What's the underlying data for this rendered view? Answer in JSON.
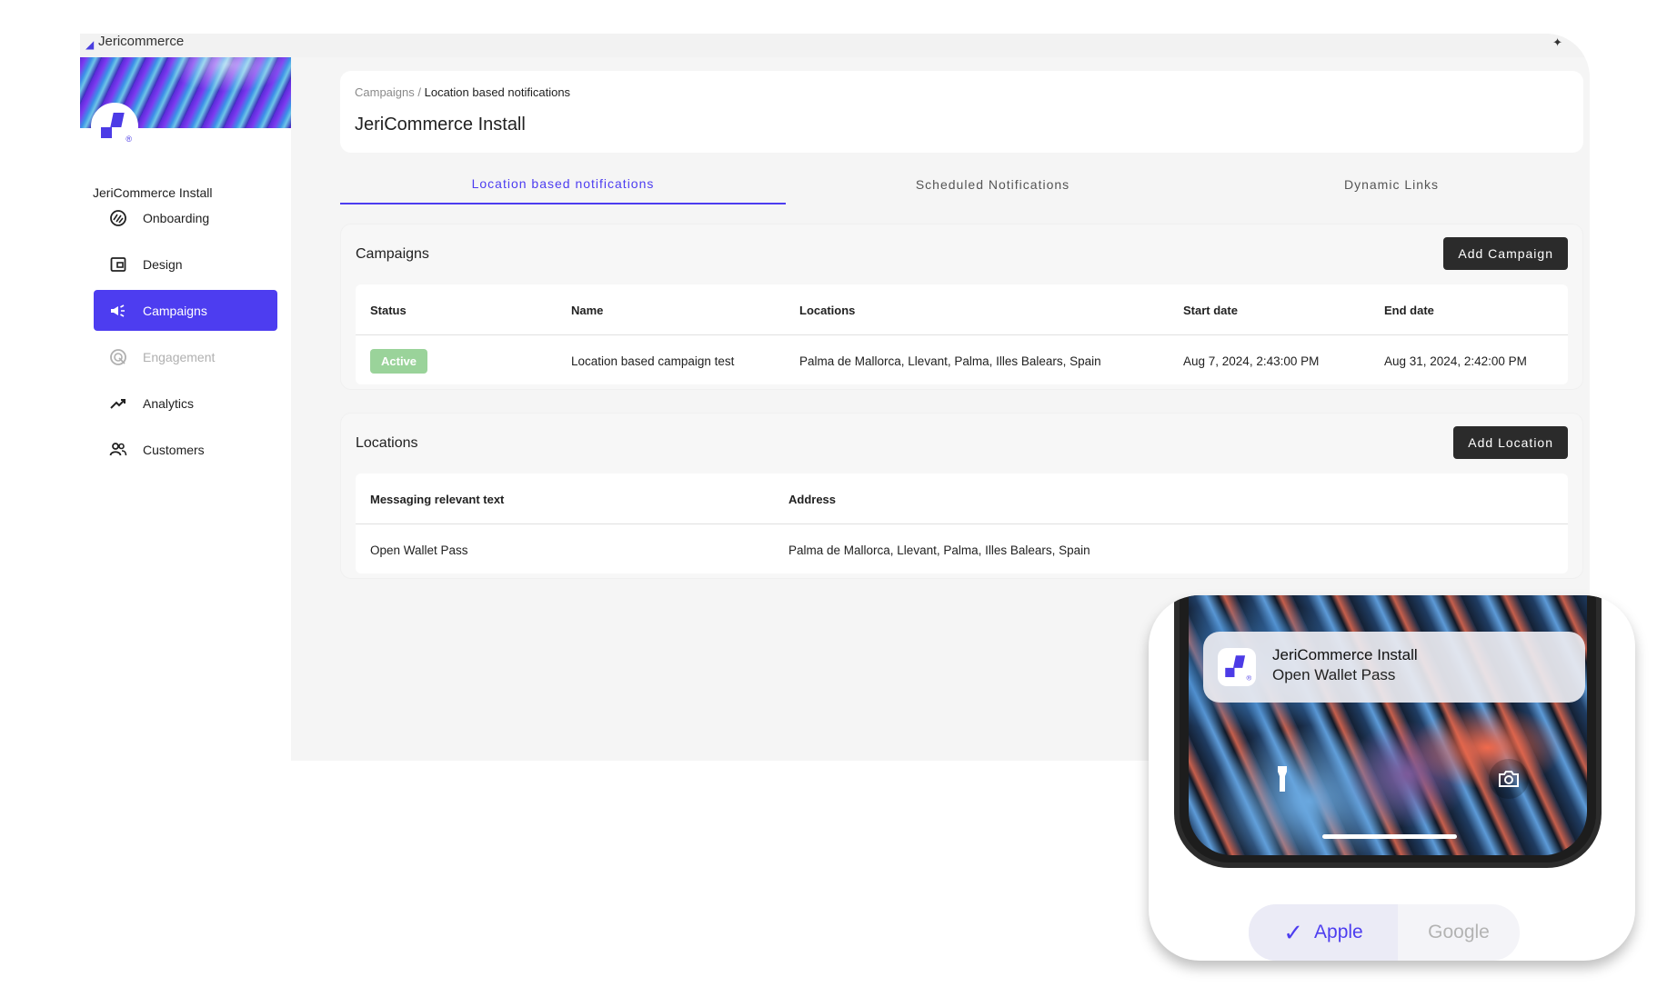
{
  "window": {
    "brand": "Jericommerce"
  },
  "sidebar": {
    "app_name": "JeriCommerce Install",
    "items": [
      {
        "label": "Onboarding",
        "icon": "onboarding-icon",
        "state": "normal"
      },
      {
        "label": "Design",
        "icon": "wallet-icon",
        "state": "normal"
      },
      {
        "label": "Campaigns",
        "icon": "campaign-icon",
        "state": "active"
      },
      {
        "label": "Engagement",
        "icon": "engagement-icon",
        "state": "disabled"
      },
      {
        "label": "Analytics",
        "icon": "trending-up-icon",
        "state": "normal"
      },
      {
        "label": "Customers",
        "icon": "people-icon",
        "state": "normal"
      }
    ]
  },
  "header": {
    "breadcrumb_parent": "Campaigns",
    "breadcrumb_separator": " / ",
    "breadcrumb_current": "Location based notifications",
    "title": "JeriCommerce Install"
  },
  "tabs": [
    {
      "label": "Location based notifications",
      "active": true
    },
    {
      "label": "Scheduled Notifications",
      "active": false
    },
    {
      "label": "Dynamic Links",
      "active": false
    }
  ],
  "campaigns": {
    "title": "Campaigns",
    "add_label": "Add Campaign",
    "columns": [
      "Status",
      "Name",
      "Locations",
      "Start date",
      "End date"
    ],
    "rows": [
      {
        "status": "Active",
        "name": "Location based campaign test",
        "locations": "Palma de Mallorca, Llevant, Palma, Illes Balears, Spain",
        "start": "Aug 7, 2024, 2:43:00 PM",
        "end": "Aug 31, 2024, 2:42:00 PM"
      }
    ]
  },
  "locations": {
    "title": "Locations",
    "add_label": "Add Location",
    "columns": [
      "Messaging relevant text",
      "Address"
    ],
    "rows": [
      {
        "text": "Open Wallet Pass",
        "address": "Palma de Mallorca, Llevant, Palma, Illes Balears, Spain"
      }
    ]
  },
  "preview": {
    "notification_title": "JeriCommerce Install",
    "notification_body": "Open Wallet Pass",
    "platform_selected": "Apple",
    "platform_other": "Google"
  },
  "colors": {
    "accent": "#4d3df0",
    "active_badge": "#9ad39a",
    "dark_button": "#2b2b2b"
  }
}
